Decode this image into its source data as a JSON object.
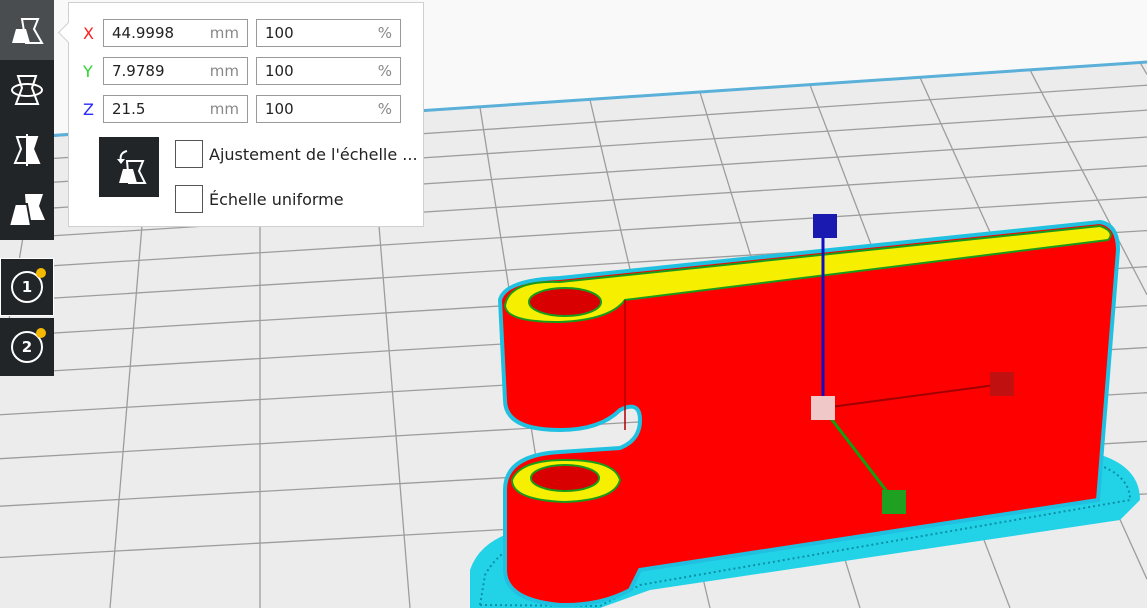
{
  "scale_panel": {
    "rows": [
      {
        "axis": "X",
        "color": "#ff1f1f",
        "mm": "44.9998",
        "mm_unit": "mm",
        "percent": "100",
        "percent_unit": "%"
      },
      {
        "axis": "Y",
        "color": "#2bd42b",
        "mm": "7.9789",
        "mm_unit": "mm",
        "percent": "100",
        "percent_unit": "%"
      },
      {
        "axis": "Z",
        "color": "#2a2aff",
        "mm": "21.5",
        "mm_unit": "mm",
        "percent": "100",
        "percent_unit": "%"
      }
    ],
    "snap_label": "Ajustement de l'échelle ...",
    "uniform_label": "Échelle uniforme"
  },
  "toolbar": {
    "tools": [
      "scale-icon",
      "rotate-icon",
      "mirror-icon",
      "per-model-settings-icon"
    ],
    "active_tool": "scale-icon"
  },
  "extruders": [
    {
      "label": "1",
      "selected": true,
      "dot_color": "#f5b900"
    },
    {
      "label": "2",
      "selected": false,
      "dot_color": "#f5b900"
    }
  ]
}
